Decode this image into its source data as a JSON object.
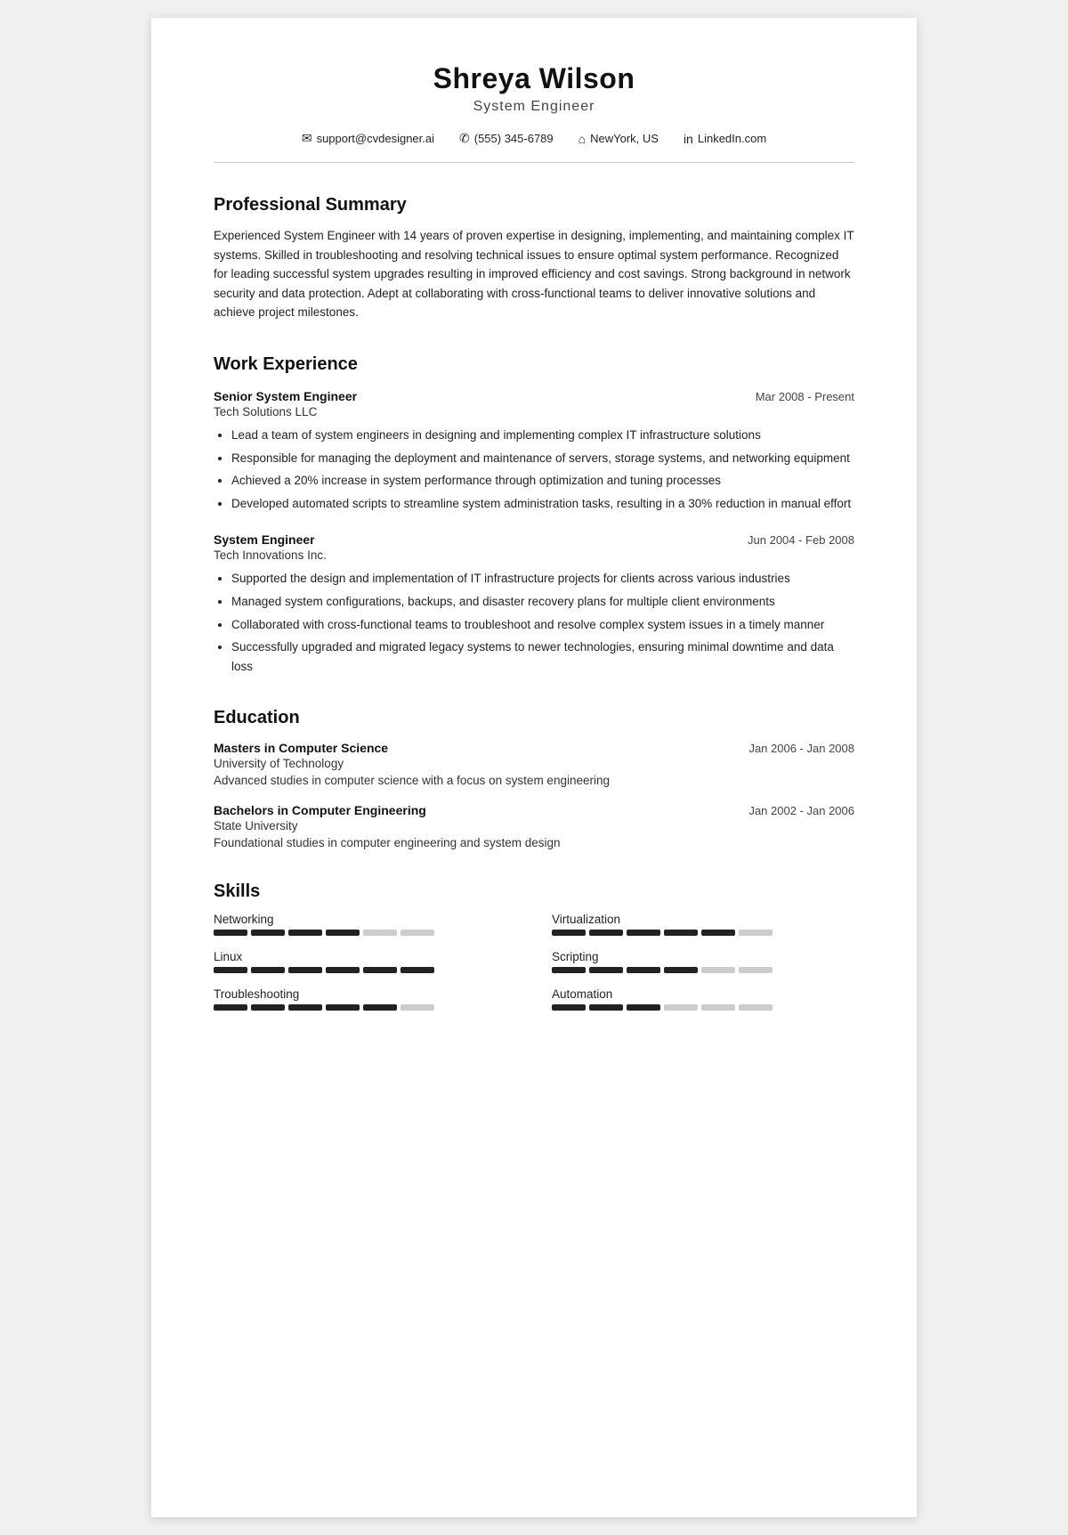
{
  "header": {
    "name": "Shreya Wilson",
    "title": "System Engineer"
  },
  "contact": {
    "email": "support@cvdesigner.ai",
    "phone": "(555) 345-6789",
    "location": "NewYork, US",
    "linkedin": "LinkedIn.com"
  },
  "summary": {
    "section_title": "Professional Summary",
    "text": "Experienced System Engineer with 14 years of proven expertise in designing, implementing, and maintaining complex IT systems. Skilled in troubleshooting and resolving technical issues to ensure optimal system performance. Recognized for leading successful system upgrades resulting in improved efficiency and cost savings. Strong background in network security and data protection. Adept at collaborating with cross-functional teams to deliver innovative solutions and achieve project milestones."
  },
  "work_experience": {
    "section_title": "Work Experience",
    "jobs": [
      {
        "title": "Senior System Engineer",
        "company": "Tech Solutions LLC",
        "date": "Mar 2008 - Present",
        "bullets": [
          "Lead a team of system engineers in designing and implementing complex IT infrastructure solutions",
          "Responsible for managing the deployment and maintenance of servers, storage systems, and networking equipment",
          "Achieved a 20% increase in system performance through optimization and tuning processes",
          "Developed automated scripts to streamline system administration tasks, resulting in a 30% reduction in manual effort"
        ]
      },
      {
        "title": "System Engineer",
        "company": "Tech Innovations Inc.",
        "date": "Jun 2004 - Feb 2008",
        "bullets": [
          "Supported the design and implementation of IT infrastructure projects for clients across various industries",
          "Managed system configurations, backups, and disaster recovery plans for multiple client environments",
          "Collaborated with cross-functional teams to troubleshoot and resolve complex system issues in a timely manner",
          "Successfully upgraded and migrated legacy systems to newer technologies, ensuring minimal downtime and data loss"
        ]
      }
    ]
  },
  "education": {
    "section_title": "Education",
    "degrees": [
      {
        "title": "Masters in Computer Science",
        "school": "University of Technology",
        "date": "Jan 2006 - Jan 2008",
        "desc": "Advanced studies in computer science with a focus on system engineering"
      },
      {
        "title": "Bachelors in Computer Engineering",
        "school": "State University",
        "date": "Jan 2002 - Jan 2006",
        "desc": "Foundational studies in computer engineering and system design"
      }
    ]
  },
  "skills": {
    "section_title": "Skills",
    "items": [
      {
        "name": "Networking",
        "filled": 4,
        "total": 6
      },
      {
        "name": "Virtualization",
        "filled": 5,
        "total": 6
      },
      {
        "name": "Linux",
        "filled": 6,
        "total": 6
      },
      {
        "name": "Scripting",
        "filled": 4,
        "total": 6
      },
      {
        "name": "Troubleshooting",
        "filled": 5,
        "total": 6
      },
      {
        "name": "Automation",
        "filled": 3,
        "total": 6
      }
    ]
  }
}
